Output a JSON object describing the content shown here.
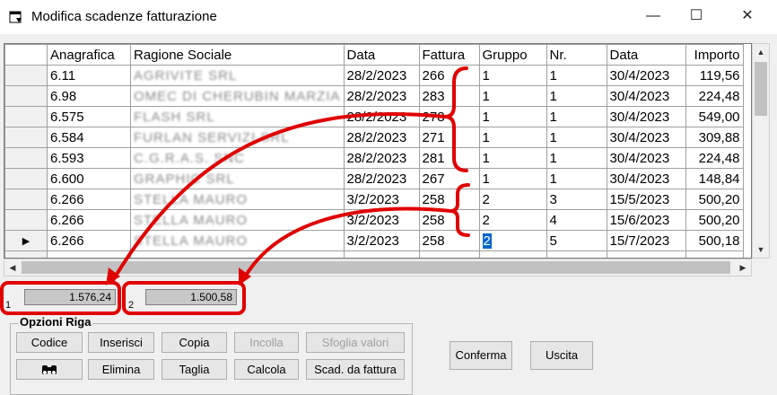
{
  "window": {
    "title": "Modifica scadenze fatturazione",
    "minimize": "—",
    "maximize": "☐",
    "close": "✕"
  },
  "grid": {
    "columns": [
      "Anagrafica",
      "Ragione Sociale",
      "Data",
      "Fattura",
      "Gruppo",
      "Nr.",
      "Data",
      "Importo"
    ],
    "rows": [
      {
        "indicator": "",
        "cells": [
          "6.11",
          "AGRIVITE SRL",
          "28/2/2023",
          "266",
          "1",
          "1",
          "30/4/2023",
          "119,56"
        ]
      },
      {
        "indicator": "",
        "cells": [
          "6.98",
          "OMEC DI CHERUBIN MARZIA",
          "28/2/2023",
          "283",
          "1",
          "1",
          "30/4/2023",
          "224,48"
        ]
      },
      {
        "indicator": "",
        "cells": [
          "6.575",
          "FLASH SRL",
          "28/2/2023",
          "278",
          "1",
          "1",
          "30/4/2023",
          "549,00"
        ]
      },
      {
        "indicator": "",
        "cells": [
          "6.584",
          "FURLAN SERVIZI SRL",
          "28/2/2023",
          "271",
          "1",
          "1",
          "30/4/2023",
          "309,88"
        ]
      },
      {
        "indicator": "",
        "cells": [
          "6.593",
          "C.G.R.A.S. SNC",
          "28/2/2023",
          "281",
          "1",
          "1",
          "30/4/2023",
          "224,48"
        ]
      },
      {
        "indicator": "",
        "cells": [
          "6.600",
          "GRAPHIC SRL",
          "28/2/2023",
          "267",
          "1",
          "1",
          "30/4/2023",
          "148,84"
        ]
      },
      {
        "indicator": "",
        "cells": [
          "6.266",
          "STELLA MAURO",
          "3/2/2023",
          "258",
          "2",
          "3",
          "15/5/2023",
          "500,20"
        ]
      },
      {
        "indicator": "",
        "cells": [
          "6.266",
          "STELLA MAURO",
          "3/2/2023",
          "258",
          "2",
          "4",
          "15/6/2023",
          "500,20"
        ]
      },
      {
        "indicator": "▶",
        "cells": [
          "6.266",
          "STELLA MAURO",
          "3/2/2023",
          "258",
          "2",
          "5",
          "15/7/2023",
          "500,18"
        ]
      },
      {
        "indicator": "✱",
        "cells": [
          "",
          "",
          "",
          "",
          "",
          "",
          "",
          ""
        ]
      }
    ]
  },
  "totals": [
    {
      "index": "1",
      "value": "1.576,24"
    },
    {
      "index": "2",
      "value": "1.500,58"
    }
  ],
  "options": {
    "title": "Opzioni Riga",
    "buttons": {
      "codice": "Codice",
      "inserisci": "Inserisci",
      "copia": "Copia",
      "incolla": "Incolla",
      "sfoglia": "Sfoglia valori",
      "binoculars": "🔍",
      "elimina": "Elimina",
      "taglia": "Taglia",
      "calcola": "Calcola",
      "scad": "Scad. da fattura"
    }
  },
  "actions": {
    "conferma": "Conferma",
    "uscita": "Uscita"
  },
  "annotation_color": "#e00000"
}
